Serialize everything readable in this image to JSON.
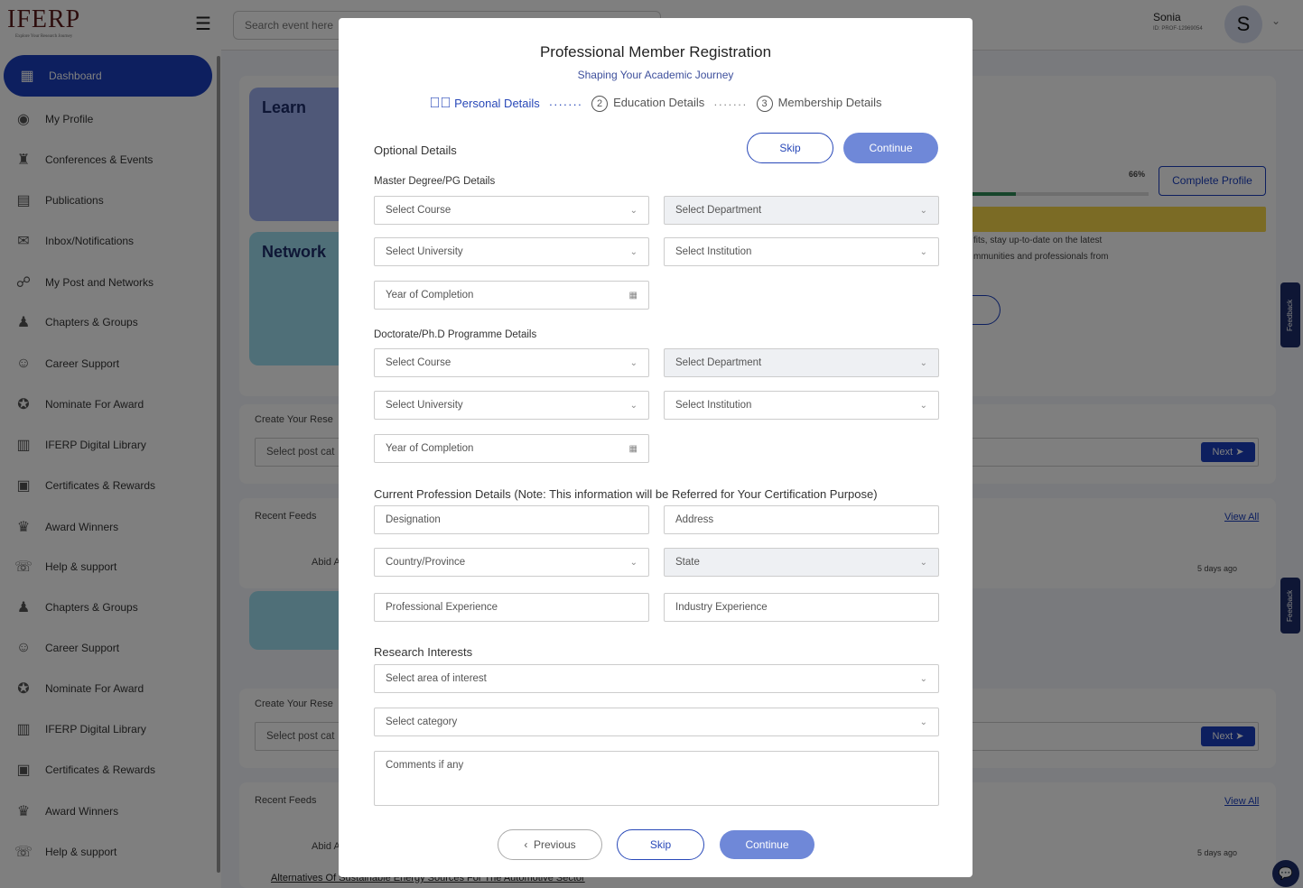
{
  "brand": {
    "name": "IFERP",
    "tagline": "Explore Your Research Journey"
  },
  "search": {
    "placeholder": "Search event here"
  },
  "user": {
    "name": "Sonia",
    "id": "ID: PROF-12969054",
    "initial": "S"
  },
  "sidebar": {
    "items": [
      {
        "label": "Dashboard",
        "icon": "grid-icon"
      },
      {
        "label": "My Profile",
        "icon": "user-icon"
      },
      {
        "label": "Conferences & Events",
        "icon": "conference-icon"
      },
      {
        "label": "Publications",
        "icon": "book-icon"
      },
      {
        "label": "Inbox/Notifications",
        "icon": "mail-icon"
      },
      {
        "label": "My Post and Networks",
        "icon": "network-icon"
      },
      {
        "label": "Chapters & Groups",
        "icon": "group-icon"
      },
      {
        "label": "Career Support",
        "icon": "career-icon"
      },
      {
        "label": "Nominate For Award",
        "icon": "award-icon"
      },
      {
        "label": "IFERP Digital Library",
        "icon": "library-icon"
      },
      {
        "label": "Certificates & Rewards",
        "icon": "certificate-icon"
      },
      {
        "label": "Award Winners",
        "icon": "trophy-icon"
      },
      {
        "label": "Help & support",
        "icon": "help-icon"
      },
      {
        "label": "Chapters & Groups",
        "icon": "group-icon"
      },
      {
        "label": "Career Support",
        "icon": "career-icon"
      },
      {
        "label": "Nominate For Award",
        "icon": "award-icon"
      },
      {
        "label": "IFERP Digital Library",
        "icon": "library-icon"
      },
      {
        "label": "Certificates & Rewards",
        "icon": "certificate-icon"
      },
      {
        "label": "Award Winners",
        "icon": "trophy-icon"
      },
      {
        "label": "Help & support",
        "icon": "help-icon"
      }
    ]
  },
  "dashboard": {
    "learn": "Learn",
    "network": "Network",
    "profile_percent": "66%",
    "profile_progress": 0.66,
    "complete_profile": "Complete Profile",
    "info1": "fits, stay up-to-date on the latest",
    "info2": "mmunities and professionals from",
    "create_post": "Create Your Rese",
    "select_post": "Select post cat",
    "next": "Next",
    "recent_feeds": "Recent Feeds",
    "view_all": "View All",
    "author": "Abid A",
    "ago": "5 days ago",
    "article": "Alternatives Of Sustainable Energy Sources For The Automotive Sector",
    "feedback": "Feedback"
  },
  "modal": {
    "title": "Professional Member Registration",
    "subtitle": "Shaping Your Academic Journey",
    "steps": [
      {
        "label": "Personal Details",
        "state": "done"
      },
      {
        "num": "2",
        "label": "Education Details"
      },
      {
        "num": "3",
        "label": "Membership Details"
      }
    ],
    "optional": "Optional Details",
    "skip": "Skip",
    "continue": "Continue",
    "previous": "Previous",
    "master": {
      "heading": "Master Degree/PG Details",
      "course": "Select Course",
      "department": "Select Department",
      "university": "Select University",
      "institution": "Select Institution",
      "year": "Year of Completion"
    },
    "phd": {
      "heading": "Doctorate/Ph.D Programme Details",
      "course": "Select Course",
      "department": "Select Department",
      "university": "Select University",
      "institution": "Select Institution",
      "year": "Year of Completion"
    },
    "profession": {
      "heading": "Current Profession Details (Note: This information will be Referred for Your Certification Purpose)",
      "designation": "Designation",
      "address": "Address",
      "country": "Country/Province",
      "state": "State",
      "professional_exp": "Professional Experience",
      "industry_exp": "Industry Experience"
    },
    "research": {
      "heading": "Research Interests",
      "area": "Select area of interest",
      "category": "Select category",
      "comments": "Comments if any"
    }
  },
  "colors": {
    "primary": "#1a3fbf",
    "continue": "#6f88d8",
    "progress": "#2e8b57",
    "warning": "#f7d64a"
  }
}
